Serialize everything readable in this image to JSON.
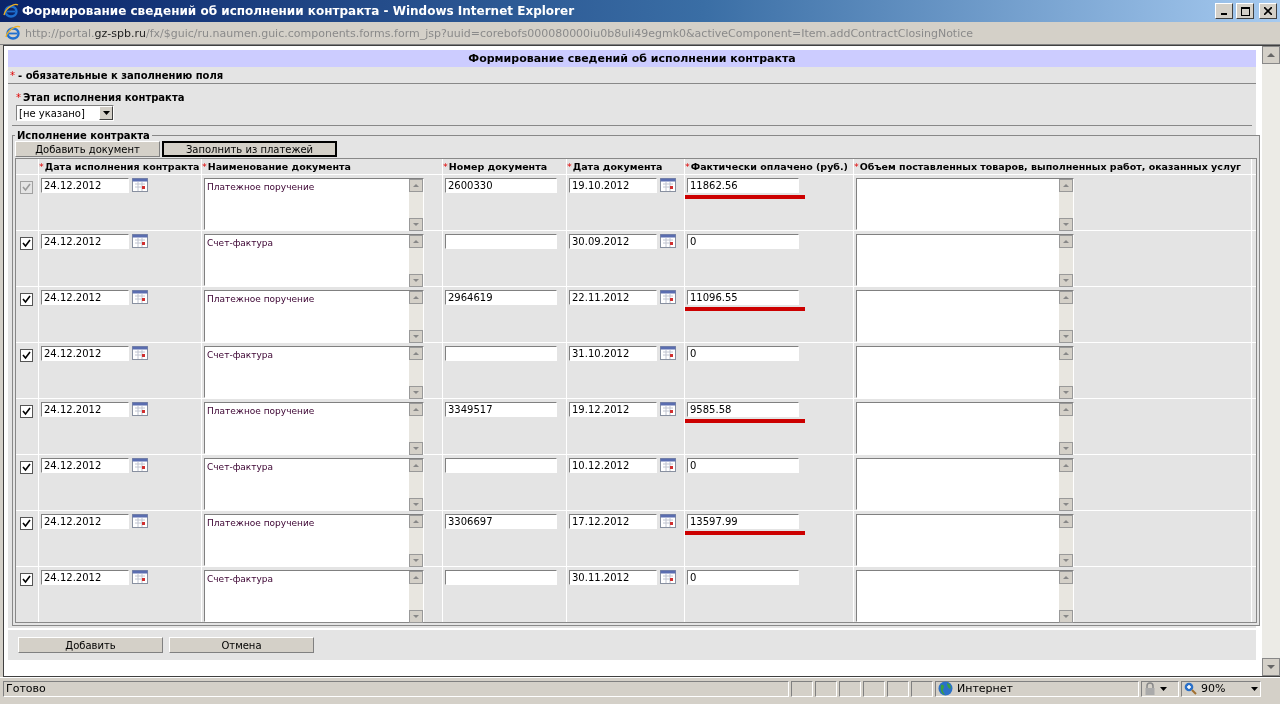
{
  "window": {
    "title": "Формирование сведений об исполнении контракта - Windows Internet Explorer"
  },
  "address_bar": {
    "url_prefix": "http://portal.",
    "url_domain": "gz-spb.ru",
    "url_path": "/fx/$guic/ru.naumen.guic.components.forms.form_jsp?uuid=corebofs000080000iu0b8uli49egmk0&activeComponent=Item.addContractClosingNotice"
  },
  "form": {
    "title": "Формирование сведений об исполнении контракта",
    "required_mark": "*",
    "required_note": "- обязательные к заполнению поля",
    "stage": {
      "mark": "*",
      "label": "Этап исполнения контракта",
      "value": "[не указано]"
    },
    "section_title": "Исполнение контракта",
    "toolbar": [
      {
        "label": "Добавить документ",
        "focused": false
      },
      {
        "label": "Заполнить из платежей",
        "focused": true
      }
    ],
    "columns": [
      {
        "mark": "*",
        "label": "Дата исполнения контракта"
      },
      {
        "mark": "*",
        "label": "Наименование документа"
      },
      {
        "mark": "*",
        "label": "Номер документа"
      },
      {
        "mark": "*",
        "label": "Дата документа"
      },
      {
        "mark": "*",
        "label": "Фактически оплачено (руб.)"
      },
      {
        "mark": "*",
        "label": "Объем поставленных товаров, выполненных работ, оказанных услуг"
      }
    ],
    "rows": [
      {
        "checked": true,
        "disabled": true,
        "contract_date": "24.12.2012",
        "document_name": "Платежное поручение",
        "document_number": "2600330",
        "document_date": "19.10.2012",
        "paid": "11862.56",
        "underlined": true
      },
      {
        "checked": true,
        "disabled": false,
        "contract_date": "24.12.2012",
        "document_name": "Счет-фактура",
        "document_date": "30.09.2012",
        "paid": "0",
        "underlined": false
      },
      {
        "checked": true,
        "disabled": false,
        "contract_date": "24.12.2012",
        "document_name": "Платежное поручение",
        "document_number": "2964619",
        "document_date": "22.11.2012",
        "paid": "11096.55",
        "underlined": true
      },
      {
        "checked": true,
        "disabled": false,
        "contract_date": "24.12.2012",
        "document_name": "Счет-фактура",
        "document_date": "31.10.2012",
        "paid": "0",
        "underlined": false
      },
      {
        "checked": true,
        "disabled": false,
        "contract_date": "24.12.2012",
        "document_name": "Платежное поручение",
        "document_number": "3349517",
        "document_date": "19.12.2012",
        "paid": "9585.58",
        "underlined": true
      },
      {
        "checked": true,
        "disabled": false,
        "contract_date": "24.12.2012",
        "document_name": "Счет-фактура",
        "document_date": "10.12.2012",
        "paid": "0",
        "underlined": false
      },
      {
        "checked": true,
        "disabled": false,
        "contract_date": "24.12.2012",
        "document_name": "Платежное поручение",
        "document_number": "3306697",
        "document_date": "17.12.2012",
        "paid": "13597.99",
        "underlined": true
      },
      {
        "checked": true,
        "disabled": false,
        "contract_date": "24.12.2012",
        "document_name": "Счет-фактура",
        "document_date": "30.11.2012",
        "paid": "0",
        "underlined": false
      }
    ],
    "buttons": [
      "Добавить",
      "Отмена"
    ]
  },
  "status_bar": {
    "text": "Готово",
    "zone": "Интернет",
    "zoom": "90%"
  }
}
